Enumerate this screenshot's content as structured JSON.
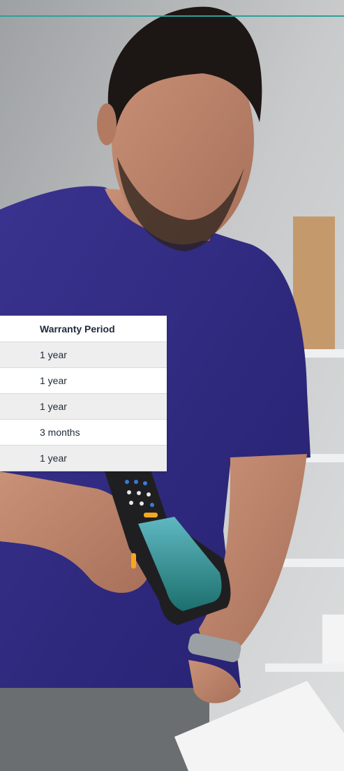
{
  "table": {
    "header": "Warranty Period",
    "rows": [
      "1 year",
      "1 year",
      "1 year",
      "3 months",
      "1 year"
    ]
  },
  "colors": {
    "accent_rule": "#2aa198",
    "shirt": "#2f2a7e",
    "device": "#1f1f21",
    "device_screen": "#1f8d84",
    "device_keys_blue": "#3a7bd5",
    "device_keys_orange": "#f5a623"
  },
  "scene": {
    "background": "photo-warehouse-man-scanning",
    "device": "handheld-barcode-scanner-icon"
  }
}
